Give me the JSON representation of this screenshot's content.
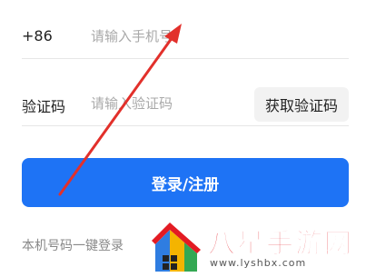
{
  "form": {
    "country_code": "+86",
    "phone_placeholder": "请输入手机号",
    "code_label": "验证码",
    "code_placeholder": "请输入验证码",
    "get_code_label": "获取验证码",
    "login_label": "登录/注册",
    "one_click_label": "本机号码一键登录"
  },
  "watermark": {
    "title": "八星手游网",
    "url": "www.lyshbx.com"
  },
  "colors": {
    "primary": "#1e73f5",
    "arrow": "#e2302b",
    "watermark_red": "#e31b23"
  },
  "icons": {
    "annotation": "red-arrow",
    "watermark_logo": "colorful-house-logo"
  }
}
